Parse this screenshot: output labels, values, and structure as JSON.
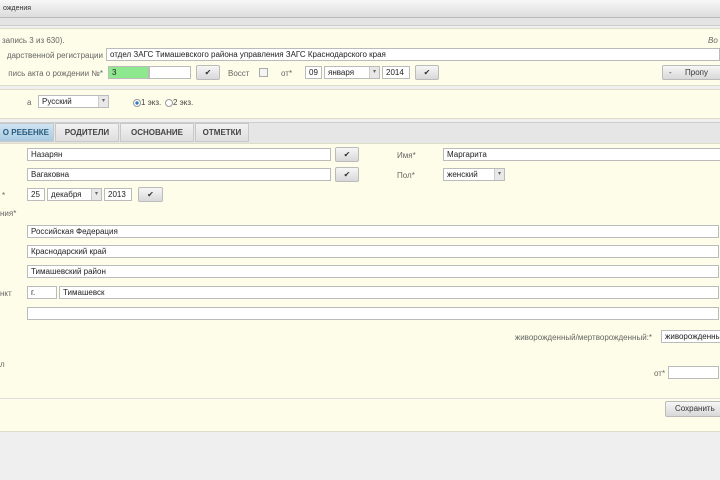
{
  "window": {
    "title": "ождения"
  },
  "header": {
    "record_info": "запись 3 из 630).",
    "right_text": "Во"
  },
  "registration": {
    "label": "дарственной регистрации",
    "value": "отдел ЗАГС Тимашевского района управления ЗАГС Краснодарского края"
  },
  "act": {
    "label": "пись акта о рождении №*",
    "number": "3",
    "number_suffix": "",
    "restore_label": "Восст",
    "from_label": "от*",
    "day": "09",
    "month": "января",
    "year": "2014",
    "skip_button": "Пропу"
  },
  "language": {
    "label": "а",
    "value": "Русский",
    "copies": [
      {
        "label": "1 экз.",
        "selected": true
      },
      {
        "label": "2 экз.",
        "selected": false
      }
    ]
  },
  "tabs": [
    {
      "label": "О РЕБЕНКЕ",
      "active": true
    },
    {
      "label": "РОДИТЕЛИ"
    },
    {
      "label": "ОСНОВАНИЕ"
    },
    {
      "label": "ОТМЕТКИ"
    }
  ],
  "child": {
    "surname": "Назарян",
    "patronymic": "Вагаковна",
    "name_label": "Имя*",
    "name": "Маргарита",
    "sex_label": "Пол*",
    "sex": "женский",
    "birth_label": "*",
    "birth_day": "25",
    "birth_month": "декабря",
    "birth_year": "2013",
    "place_label": "ния*",
    "country": "Российская Федерация",
    "region": "Краснодарский край",
    "district": "Тимашевский район",
    "locality_label": "нкт",
    "locality_type": "г.",
    "locality": "Тимашевск",
    "extra": "",
    "alive_label": "живорожденный/мертворожденный:*",
    "alive_value": "живорожденны",
    "doc_label": "л",
    "doc_from_label": "от*",
    "doc_from": ""
  },
  "footer": {
    "save_button": "Сохранить"
  }
}
